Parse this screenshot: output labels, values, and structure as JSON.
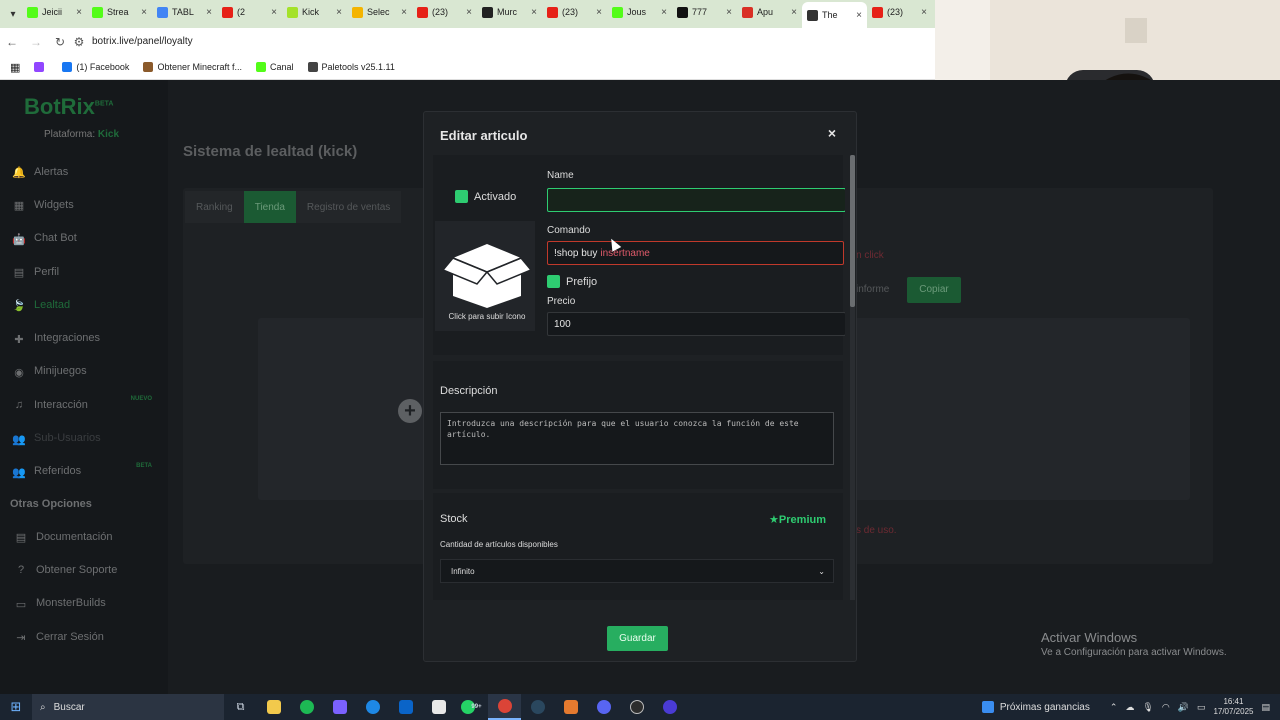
{
  "browser": {
    "tabs": [
      {
        "title": "Jeicii",
        "color": "#53fc18"
      },
      {
        "title": "Strea",
        "color": "#53fc18"
      },
      {
        "title": "TABL",
        "color": "#4285f4"
      },
      {
        "title": "(2",
        "color": "#e62117"
      },
      {
        "title": "Kick",
        "color": "#a4e22a"
      },
      {
        "title": "Selec",
        "color": "#f4b400"
      },
      {
        "title": "(23)",
        "color": "#e62117"
      },
      {
        "title": "Murc",
        "color": "#222222"
      },
      {
        "title": "(23)",
        "color": "#e62117"
      },
      {
        "title": "Jous",
        "color": "#53fc18"
      },
      {
        "title": "777",
        "color": "#111111"
      },
      {
        "title": "Apu",
        "color": "#d93025"
      },
      {
        "title": "The",
        "color": "#333333"
      },
      {
        "title": "(23)",
        "color": "#e62117"
      }
    ],
    "url": "botrix.live/panel/loyalty",
    "bookmarks": [
      {
        "label": "",
        "color": "#9146ff"
      },
      {
        "label": "(1) Facebook",
        "color": "#1877f2"
      },
      {
        "label": "Obtener Minecraft f...",
        "color": "#8b5a2b"
      },
      {
        "label": "Canal",
        "color": "#53fc18"
      },
      {
        "label": "Paletools v25.1.11",
        "color": "#444444"
      }
    ]
  },
  "app": {
    "logo": "BotRix",
    "logo_badge": "BETA",
    "platform_label": "Plataforma:",
    "platform_value": "Kick",
    "menu": [
      {
        "label": "Alertas",
        "icon": "bell-icon"
      },
      {
        "label": "Widgets",
        "icon": "grid-icon"
      },
      {
        "label": "Chat Bot",
        "icon": "robot-icon"
      },
      {
        "label": "Perfil",
        "icon": "profile-icon"
      },
      {
        "label": "Lealtad",
        "icon": "leaf-icon",
        "active": true
      },
      {
        "label": "Integraciones",
        "icon": "puzzle-icon"
      },
      {
        "label": "Minijuegos",
        "icon": "gamepad-icon"
      },
      {
        "label": "Interacción",
        "icon": "music-icon",
        "tag": "NUEVO"
      },
      {
        "label": "Sub-Usuarios",
        "icon": "users-icon",
        "disabled": true
      },
      {
        "label": "Referidos",
        "icon": "people-icon",
        "tag": "BETA"
      }
    ],
    "otras_title": "Otras Opciones",
    "menu2": [
      {
        "label": "Documentación",
        "icon": "book-icon"
      },
      {
        "label": "Obtener Soporte",
        "icon": "help-icon"
      },
      {
        "label": "MonsterBuilds",
        "icon": "monitor-icon"
      },
      {
        "label": "Cerrar Sesión",
        "icon": "logout-icon"
      }
    ],
    "page_title": "Sistema de lealtad (kick)",
    "tabs": [
      "Ranking",
      "Tienda",
      "Registro de ventas"
    ],
    "copy_label": "Copiar",
    "ghost_input": "",
    "activate_windows_title": "Activar Windows",
    "activate_windows_sub": "Ve a Configuración para activar Windows."
  },
  "modal": {
    "title": "Editar articulo",
    "close": "×",
    "activado_label": "Activado",
    "icon_caption": "Click para subir Icono",
    "name_label": "Name",
    "name_value": "",
    "comando_label": "Comando",
    "comando_value": "!shop buy",
    "comando_hint": "insertname",
    "prefijo_label": "Prefijo",
    "precio_label": "Precio",
    "precio_value": "100",
    "descripcion_label": "Descripción",
    "descripcion_placeholder": "Introduzca una descripción para que el usuario conozca la función de este artículo.",
    "stock_label": "Stock",
    "premium_label": "Premium",
    "cantidad_label": "Cantidad de artículos disponibles",
    "stock_value": "Infinito",
    "save_label": "Guardar"
  },
  "taskbar": {
    "search_label": "Buscar",
    "ganancias_label": "Próximas ganancias",
    "time": "16:41",
    "date": "17/07/2025",
    "whatsapp_badge": "99+"
  }
}
